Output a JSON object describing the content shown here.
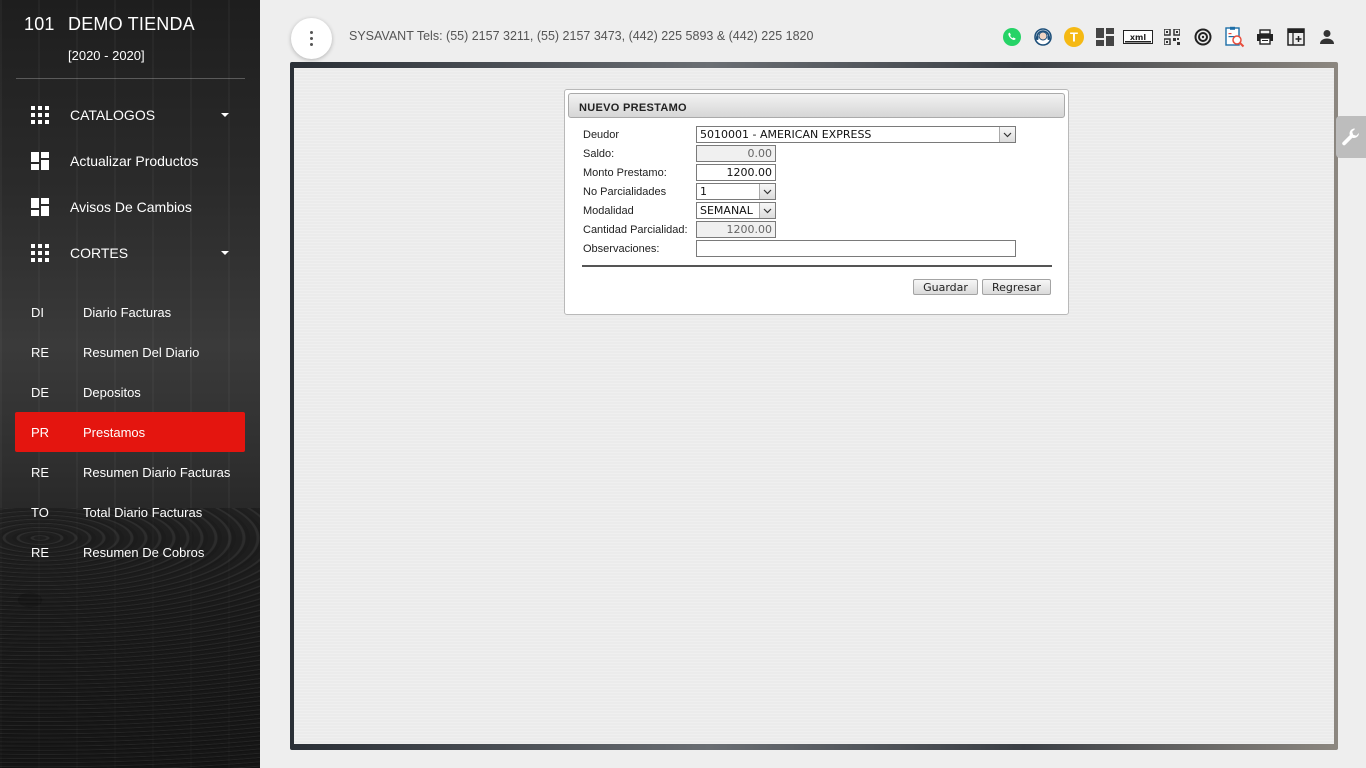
{
  "brand": {
    "store_number": "101",
    "store_name": "DEMO TIENDA",
    "period": "[2020 - 2020]"
  },
  "menu": [
    {
      "label": "CATALOGOS",
      "icon": "apps-icon",
      "has_caret": true
    },
    {
      "label": "Actualizar Productos",
      "icon": "dashboard-icon",
      "has_caret": false
    },
    {
      "label": "Avisos De Cambios",
      "icon": "dashboard-icon",
      "has_caret": false
    },
    {
      "label": "CORTES",
      "icon": "apps-icon",
      "has_caret": true
    }
  ],
  "submenu": [
    {
      "abbr": "DI",
      "label": "Diario Facturas",
      "active": false
    },
    {
      "abbr": "RE",
      "label": "Resumen Del Diario",
      "active": false
    },
    {
      "abbr": "DE",
      "label": "Depositos",
      "active": false
    },
    {
      "abbr": "PR",
      "label": "Prestamos",
      "active": true
    },
    {
      "abbr": "RE",
      "label": "Resumen Diario Facturas",
      "active": false
    },
    {
      "abbr": "TO",
      "label": "Total Diario Facturas",
      "active": false
    },
    {
      "abbr": "RE",
      "label": "Resumen De Cobros",
      "active": false
    }
  ],
  "topbar": {
    "contact_text": "SYSAVANT Tels: (55) 2157 3211, (55) 2157 3473, (442) 225 5893 & (442) 225 1820",
    "t_badge": "T",
    "xml_badge": "xml",
    "icons": [
      "whatsapp-icon",
      "support-agent-icon",
      "t-badge-icon",
      "dashboard-icon",
      "xml-icon",
      "qr-code-icon",
      "settings-icon",
      "report-search-icon",
      "print-icon",
      "add-table-icon",
      "user-icon"
    ]
  },
  "colors": {
    "accent": "#e4150f",
    "sidebar_bg": "#262626",
    "whatsapp": "#25d366",
    "badge": "#f5b914"
  },
  "form": {
    "title": "NUEVO PRESTAMO",
    "fields": {
      "deudor": {
        "label": "Deudor",
        "value": "5010001 - AMERICAN EXPRESS"
      },
      "saldo": {
        "label": "Saldo:",
        "value": "0.00"
      },
      "monto": {
        "label": "Monto Prestamo:",
        "value": "1200.00"
      },
      "parcialidades": {
        "label": "No Parcialidades",
        "value": "1"
      },
      "modalidad": {
        "label": "Modalidad",
        "value": "SEMANAL"
      },
      "cantidad": {
        "label": "Cantidad Parcialidad:",
        "value": "1200.00"
      },
      "observaciones": {
        "label": "Observaciones:",
        "value": ""
      }
    },
    "buttons": {
      "save": "Guardar",
      "back": "Regresar"
    }
  }
}
